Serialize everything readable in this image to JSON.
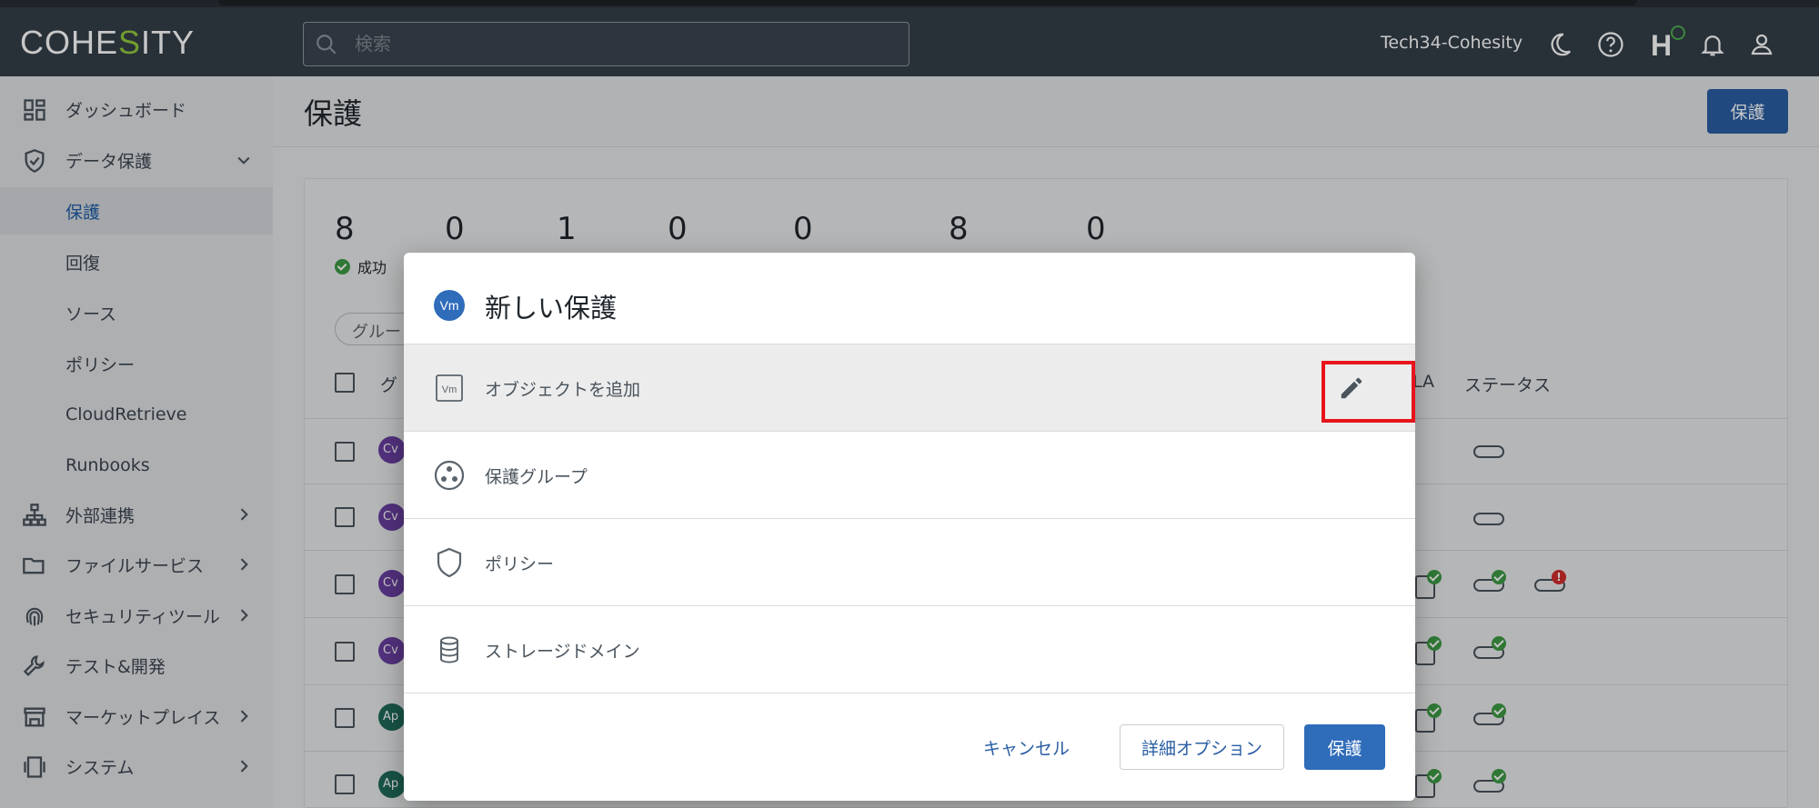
{
  "topbar": {
    "logo_prefix": "COHE",
    "logo_s": "S",
    "logo_suffix": "ITY",
    "search_placeholder": "検索",
    "tenant": "Tech34-Cohesity",
    "h_label": "H",
    "icons": [
      "moon-icon",
      "help-icon",
      "h-health-icon",
      "bell-icon",
      "user-icon"
    ],
    "accent": "#93c83e"
  },
  "sidebar": {
    "items": [
      {
        "label": "ダッシュボード",
        "icon": "dashboard-icon"
      },
      {
        "label": "データ保護",
        "icon": "shield-check-icon",
        "expanded": true
      },
      {
        "label": "保護",
        "active": true
      },
      {
        "label": "回復"
      },
      {
        "label": "ソース"
      },
      {
        "label": "ポリシー"
      },
      {
        "label": "CloudRetrieve"
      },
      {
        "label": "Runbooks"
      },
      {
        "label": "外部連携",
        "icon": "network-icon"
      },
      {
        "label": "ファイルサービス",
        "icon": "folder-icon"
      },
      {
        "label": "セキュリティツール",
        "icon": "fingerprint-icon"
      },
      {
        "label": "テスト&開発",
        "icon": "wrench-icon"
      },
      {
        "label": "マーケットプレイス",
        "icon": "store-icon"
      },
      {
        "label": "システム",
        "icon": "system-icon"
      }
    ]
  },
  "page": {
    "title": "保護",
    "header_button": "保護",
    "stats": [
      "8",
      "0",
      "1",
      "0",
      "0",
      "8",
      "0"
    ],
    "stat_label_success": "成功",
    "chip_label": "グルー",
    "col_group": "グ",
    "col_sla": "LA",
    "col_status": "ステータス",
    "rows": [
      {
        "avatar": "Cv",
        "color": "#6a3fa0"
      },
      {
        "avatar": "Cv",
        "color": "#6a3fa0"
      },
      {
        "avatar": "Cv",
        "color": "#6a3fa0"
      },
      {
        "avatar": "Cv",
        "color": "#6a3fa0"
      },
      {
        "avatar": "Ap",
        "color": "#1f6b5a"
      },
      {
        "avatar": "Ap",
        "color": "#1f6b5a"
      }
    ]
  },
  "modal": {
    "badge": "Vm",
    "title": "新しい保護",
    "rows": [
      {
        "label": "オブジェクトを追加",
        "icon": "vm-icon"
      },
      {
        "label": "保護グループ",
        "icon": "protection-group-icon"
      },
      {
        "label": "ポリシー",
        "icon": "shield-icon"
      },
      {
        "label": "ストレージドメイン",
        "icon": "database-icon"
      }
    ],
    "cancel": "キャンセル",
    "advanced": "詳細オプション",
    "protect": "保護",
    "primary_color": "#2f6cba"
  }
}
